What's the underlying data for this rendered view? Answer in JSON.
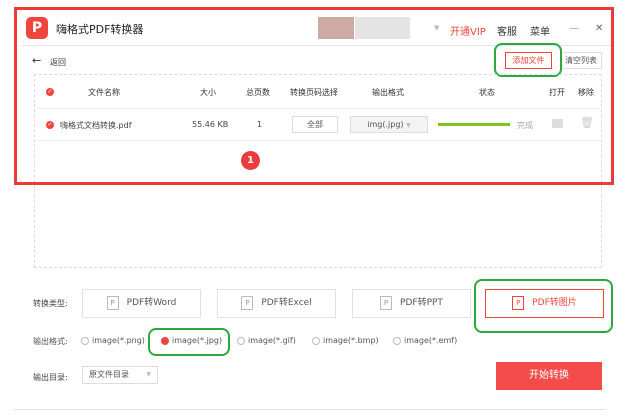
{
  "app": {
    "title": "嗨格式PDF转换器",
    "logo_letter": "P"
  },
  "header": {
    "vip": "开通VIP",
    "service": "客服",
    "menu": "菜单",
    "minimize": "—",
    "close": "✕"
  },
  "toolbar": {
    "back": "返回",
    "add_file": "添加文件",
    "clear_list": "清空列表"
  },
  "table": {
    "headers": [
      "文件名称",
      "大小",
      "总页数",
      "转换页码选择",
      "输出格式",
      "状态",
      "打开",
      "移除"
    ],
    "rows": [
      {
        "name": "嗨格式文档转换.pdf",
        "size": "55.46 KB",
        "pages": "1",
        "page_select": "全部",
        "format": "img(.jpg)",
        "status": "完成",
        "progress": 100
      }
    ]
  },
  "annotation": {
    "badge": "1"
  },
  "convert_type": {
    "label": "转换类型:",
    "options": [
      "PDF转Word",
      "PDF转Excel",
      "PDF转PPT",
      "PDF转图片"
    ],
    "selected": 3
  },
  "output_format": {
    "label": "输出格式:",
    "options": [
      "image(*.png)",
      "image(*.jpg)",
      "image(*.gif)",
      "image(*.bmp)",
      "image(*.emf)"
    ],
    "selected": 1
  },
  "output_dir": {
    "label": "输出目录:",
    "value": "原文件目录"
  },
  "start_button": "开始转换",
  "colors": {
    "accent": "#f0443e",
    "annotation_green": "#2ea83a",
    "progress": "#7cc61c"
  }
}
